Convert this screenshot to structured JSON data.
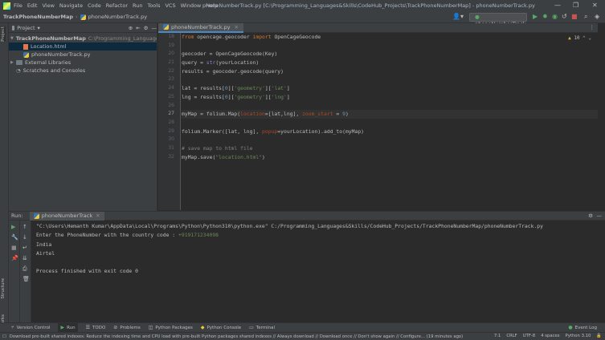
{
  "window": {
    "title": "phoneNumberTrack.py [C:\\Programming_Languages&Skills\\CodeHub_Projects\\TrackPhoneNumberMap] - phoneNumberTrack.py",
    "controls": [
      "—",
      "❐",
      "✕"
    ]
  },
  "menu": [
    "File",
    "Edit",
    "View",
    "Navigate",
    "Code",
    "Refactor",
    "Run",
    "Tools",
    "VCS",
    "Window",
    "Help"
  ],
  "breadcrumb": [
    "TrackPhoneNumberMap",
    "phoneNumberTrack.py"
  ],
  "run_config": "phoneNumberTrack",
  "project_panel": {
    "title": "Project",
    "tree": [
      {
        "label": "TrackPhoneNumberMap",
        "path": "C:\\Programming_Languages&Skills\\Cod",
        "type": "folder",
        "depth": 0,
        "expanded": true
      },
      {
        "label": "Location.html",
        "type": "html",
        "depth": 1,
        "selected": true
      },
      {
        "label": "phoneNumberTrack.py",
        "type": "py",
        "depth": 1
      },
      {
        "label": "External Libraries",
        "type": "folder",
        "depth": 0
      },
      {
        "label": "Scratches and Consoles",
        "type": "scratch",
        "depth": 0
      }
    ]
  },
  "left_stripe": [
    "Project",
    "Structure",
    "Bookmarks"
  ],
  "editor": {
    "tab": "phoneNumberTrack.py",
    "inspection": "10",
    "lines": [
      {
        "num": "18",
        "text": "from opencage.geocoder import OpenCageGeocode"
      },
      {
        "num": "19",
        "text": ""
      },
      {
        "num": "20",
        "text": "geocoder = OpenCageGeocode(Key)"
      },
      {
        "num": "21",
        "text": "query = str(yourLocation)"
      },
      {
        "num": "22",
        "text": "results = geocoder.geocode(query)"
      },
      {
        "num": "23",
        "text": ""
      },
      {
        "num": "24",
        "text": "lat = results[0]['geometry']['lat']"
      },
      {
        "num": "25",
        "text": "lng = results[0]['geometry']['lng']"
      },
      {
        "num": "26",
        "text": ""
      },
      {
        "num": "27",
        "text": "myMap = folium.Map(location=[lat,lng], zoom_start = 9)"
      },
      {
        "num": "28",
        "text": ""
      },
      {
        "num": "29",
        "text": "folium.Marker([lat, lng], popup=yourLocation).add_to(myMap)"
      },
      {
        "num": "30",
        "text": ""
      },
      {
        "num": "31",
        "text": "# save map to html file"
      },
      {
        "num": "32",
        "text": "myMap.save(\"location.html\")"
      }
    ],
    "active_line": "27"
  },
  "run_panel": {
    "label": "Run:",
    "tab": "phoneNumberTrack",
    "output": [
      "\"C:\\Users\\Hemanth Kumar\\AppData\\Local\\Programs\\Python\\Python310\\python.exe\" C:/Programming_Languages&Skills/CodeHub_Projects/TrackPhoneNumberMap/phoneNumberTrack.py",
      "Enter the PhoneNumber with the country code : ",
      "India",
      "Airtel",
      "",
      "Process finished with exit code 0"
    ],
    "user_input": "+919171234098"
  },
  "tool_windows": [
    {
      "label": "Version Control",
      "icon": "branch-icon"
    },
    {
      "label": "Run",
      "icon": "play-icon",
      "active": true
    },
    {
      "label": "TODO",
      "icon": "list-icon"
    },
    {
      "label": "Problems",
      "icon": "problem-icon"
    },
    {
      "label": "Python Packages",
      "icon": "package-icon"
    },
    {
      "label": "Python Console",
      "icon": "python-icon"
    },
    {
      "label": "Terminal",
      "icon": "terminal-icon"
    }
  ],
  "event_log": "Event Log",
  "status": {
    "message": "Download pre-built shared indexes: Reduce the indexing time and CPU load with pre-built Python packages shared indexes // Always download // Download once // Don't show again // Configure... (19 minutes ago)",
    "position": "7:1",
    "line_sep": "CRLF",
    "encoding": "UTF-8",
    "indent": "4 spaces",
    "interpreter": "Python 3.10"
  },
  "colors": {
    "accent": "#4a88c7",
    "run_green": "#59a869",
    "error_red": "#c75450"
  }
}
